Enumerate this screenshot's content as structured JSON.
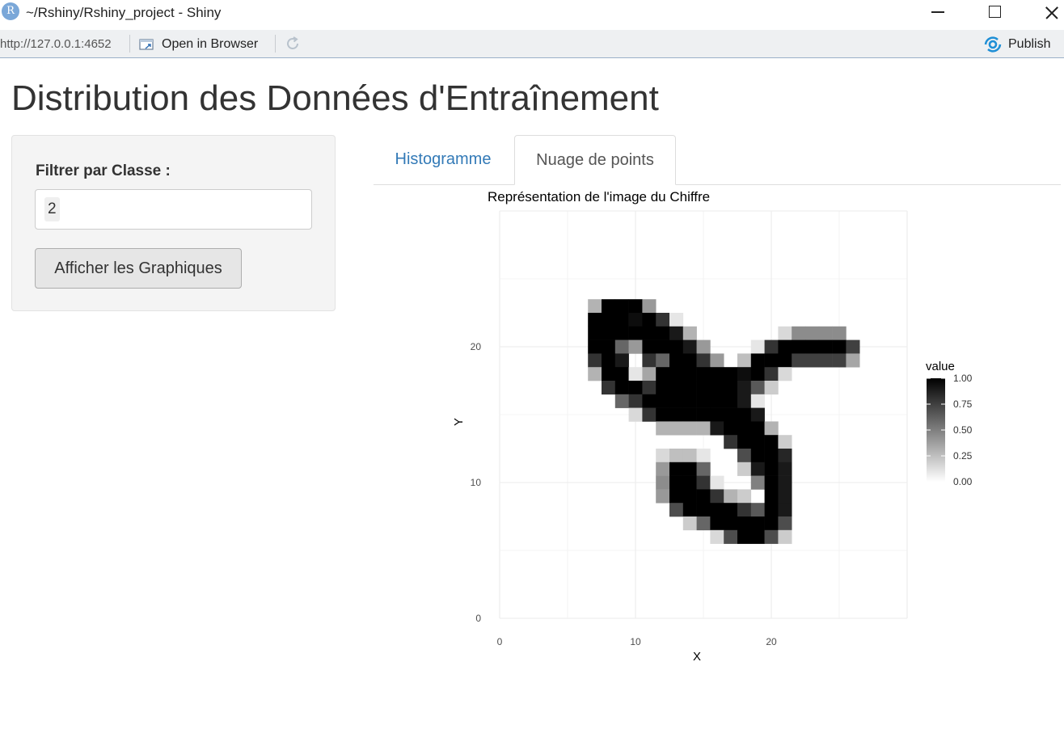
{
  "window": {
    "title": "~/Rshiny/Rshiny_project - Shiny",
    "app_icon": "R"
  },
  "toolbar": {
    "url": "http://127.0.0.1:4652",
    "open_in_browser": "Open in Browser",
    "publish": "Publish"
  },
  "page": {
    "title": "Distribution des Données d'Entraînement"
  },
  "sidebar": {
    "filter_label": "Filtrer par Classe :",
    "selected_class": "2",
    "show_button": "Afficher les Graphiques"
  },
  "tabs": [
    {
      "label": "Histogramme",
      "active": false
    },
    {
      "label": "Nuage de points",
      "active": true
    }
  ],
  "chart_data": {
    "type": "heatmap",
    "title": "Représentation de l'image du Chiffre",
    "xlabel": "X",
    "ylabel": "Y",
    "xlim": [
      0,
      30
    ],
    "ylim": [
      0,
      30
    ],
    "x_ticks": [
      0,
      10,
      20
    ],
    "y_ticks": [
      0,
      10,
      20
    ],
    "grid": true,
    "legend": {
      "title": "value",
      "position": "right",
      "ticks": [
        "1.00",
        "0.75",
        "0.50",
        "0.25",
        "0.00"
      ],
      "low_color": "#ffffff",
      "high_color": "#000000"
    },
    "cells": [
      [
        7,
        23,
        0.3
      ],
      [
        8,
        23,
        1
      ],
      [
        9,
        23,
        1
      ],
      [
        10,
        23,
        1
      ],
      [
        11,
        23,
        0.4
      ],
      [
        7,
        22,
        1
      ],
      [
        8,
        22,
        1
      ],
      [
        9,
        22,
        1
      ],
      [
        10,
        22,
        0.95
      ],
      [
        11,
        22,
        1
      ],
      [
        12,
        22,
        0.8
      ],
      [
        13,
        22,
        0.1
      ],
      [
        7,
        21,
        1
      ],
      [
        8,
        21,
        1
      ],
      [
        9,
        21,
        1
      ],
      [
        10,
        21,
        1
      ],
      [
        11,
        21,
        1
      ],
      [
        12,
        21,
        1
      ],
      [
        13,
        21,
        0.9
      ],
      [
        14,
        21,
        0.3
      ],
      [
        21,
        21,
        0.15
      ],
      [
        22,
        21,
        0.45
      ],
      [
        23,
        21,
        0.45
      ],
      [
        24,
        21,
        0.45
      ],
      [
        25,
        21,
        0.45
      ],
      [
        7,
        20,
        1
      ],
      [
        8,
        20,
        1
      ],
      [
        9,
        20,
        0.6
      ],
      [
        10,
        20,
        0.4
      ],
      [
        11,
        20,
        1
      ],
      [
        12,
        20,
        1
      ],
      [
        13,
        20,
        1
      ],
      [
        14,
        20,
        0.9
      ],
      [
        15,
        20,
        0.4
      ],
      [
        19,
        20,
        0.1
      ],
      [
        20,
        20,
        0.8
      ],
      [
        21,
        20,
        1
      ],
      [
        22,
        20,
        1
      ],
      [
        23,
        20,
        1
      ],
      [
        24,
        20,
        1
      ],
      [
        25,
        20,
        1
      ],
      [
        26,
        20,
        0.75
      ],
      [
        7,
        19,
        0.8
      ],
      [
        8,
        19,
        1
      ],
      [
        9,
        19,
        0.9
      ],
      [
        11,
        19,
        0.8
      ],
      [
        12,
        19,
        0.6
      ],
      [
        13,
        19,
        1
      ],
      [
        14,
        19,
        1
      ],
      [
        15,
        19,
        0.8
      ],
      [
        16,
        19,
        0.4
      ],
      [
        18,
        19,
        0.25
      ],
      [
        19,
        19,
        1
      ],
      [
        20,
        19,
        1
      ],
      [
        21,
        19,
        1
      ],
      [
        22,
        19,
        0.75
      ],
      [
        23,
        19,
        0.75
      ],
      [
        24,
        19,
        0.75
      ],
      [
        25,
        19,
        0.75
      ],
      [
        26,
        19,
        0.35
      ],
      [
        7,
        18,
        0.3
      ],
      [
        8,
        18,
        1
      ],
      [
        9,
        18,
        1
      ],
      [
        10,
        18,
        0.1
      ],
      [
        11,
        18,
        0.35
      ],
      [
        12,
        18,
        1
      ],
      [
        13,
        18,
        1
      ],
      [
        14,
        18,
        1
      ],
      [
        15,
        18,
        1
      ],
      [
        16,
        18,
        1
      ],
      [
        17,
        18,
        1
      ],
      [
        18,
        18,
        0.95
      ],
      [
        19,
        18,
        1
      ],
      [
        20,
        18,
        0.8
      ],
      [
        21,
        18,
        0.15
      ],
      [
        8,
        17,
        0.8
      ],
      [
        9,
        17,
        1
      ],
      [
        10,
        17,
        1
      ],
      [
        11,
        17,
        0.8
      ],
      [
        12,
        17,
        1
      ],
      [
        13,
        17,
        1
      ],
      [
        14,
        17,
        1
      ],
      [
        15,
        17,
        1
      ],
      [
        16,
        17,
        1
      ],
      [
        17,
        17,
        1
      ],
      [
        18,
        17,
        0.9
      ],
      [
        19,
        17,
        0.65
      ],
      [
        20,
        17,
        0.2
      ],
      [
        9,
        16,
        0.6
      ],
      [
        10,
        16,
        0.8
      ],
      [
        11,
        16,
        1
      ],
      [
        12,
        16,
        1
      ],
      [
        13,
        16,
        1
      ],
      [
        14,
        16,
        1
      ],
      [
        15,
        16,
        1
      ],
      [
        16,
        16,
        1
      ],
      [
        17,
        16,
        1
      ],
      [
        18,
        16,
        0.9
      ],
      [
        19,
        16,
        0.1
      ],
      [
        10,
        15,
        0.15
      ],
      [
        11,
        15,
        0.8
      ],
      [
        12,
        15,
        1
      ],
      [
        13,
        15,
        1
      ],
      [
        14,
        15,
        1
      ],
      [
        15,
        15,
        1
      ],
      [
        16,
        15,
        1
      ],
      [
        17,
        15,
        1
      ],
      [
        18,
        15,
        1
      ],
      [
        19,
        15,
        0.9
      ],
      [
        12,
        14,
        0.3
      ],
      [
        13,
        14,
        0.3
      ],
      [
        14,
        14,
        0.3
      ],
      [
        15,
        14,
        0.3
      ],
      [
        16,
        14,
        0.9
      ],
      [
        17,
        14,
        1
      ],
      [
        18,
        14,
        1
      ],
      [
        19,
        14,
        1
      ],
      [
        20,
        14,
        0.3
      ],
      [
        17,
        13,
        0.8
      ],
      [
        18,
        13,
        1
      ],
      [
        19,
        13,
        1
      ],
      [
        20,
        13,
        1
      ],
      [
        21,
        13,
        0.2
      ],
      [
        12,
        12,
        0.15
      ],
      [
        13,
        12,
        0.25
      ],
      [
        14,
        12,
        0.25
      ],
      [
        15,
        12,
        0.1
      ],
      [
        18,
        12,
        0.7
      ],
      [
        19,
        12,
        1
      ],
      [
        20,
        12,
        1
      ],
      [
        21,
        12,
        0.85
      ],
      [
        12,
        11,
        0.4
      ],
      [
        13,
        11,
        1
      ],
      [
        14,
        11,
        1
      ],
      [
        15,
        11,
        0.6
      ],
      [
        18,
        11,
        0.2
      ],
      [
        19,
        11,
        0.9
      ],
      [
        20,
        11,
        1
      ],
      [
        21,
        11,
        0.9
      ],
      [
        12,
        10,
        0.45
      ],
      [
        13,
        10,
        1
      ],
      [
        14,
        10,
        1
      ],
      [
        15,
        10,
        0.8
      ],
      [
        16,
        10,
        0.1
      ],
      [
        19,
        10,
        0.5
      ],
      [
        20,
        10,
        1
      ],
      [
        21,
        10,
        0.9
      ],
      [
        12,
        9,
        0.4
      ],
      [
        13,
        9,
        1
      ],
      [
        14,
        9,
        1
      ],
      [
        15,
        9,
        1
      ],
      [
        16,
        9,
        0.8
      ],
      [
        17,
        9,
        0.3
      ],
      [
        18,
        9,
        0.2
      ],
      [
        20,
        9,
        1
      ],
      [
        21,
        9,
        0.9
      ],
      [
        13,
        8,
        0.7
      ],
      [
        14,
        8,
        1
      ],
      [
        15,
        8,
        1
      ],
      [
        16,
        8,
        1
      ],
      [
        17,
        8,
        1
      ],
      [
        18,
        8,
        0.8
      ],
      [
        19,
        8,
        0.65
      ],
      [
        20,
        8,
        1
      ],
      [
        21,
        8,
        0.9
      ],
      [
        14,
        7,
        0.2
      ],
      [
        15,
        7,
        0.6
      ],
      [
        16,
        7,
        1
      ],
      [
        17,
        7,
        1
      ],
      [
        18,
        7,
        1
      ],
      [
        19,
        7,
        1
      ],
      [
        20,
        7,
        1
      ],
      [
        21,
        7,
        0.7
      ],
      [
        16,
        6,
        0.15
      ],
      [
        17,
        6,
        0.7
      ],
      [
        18,
        6,
        1
      ],
      [
        19,
        6,
        1
      ],
      [
        20,
        6,
        0.7
      ],
      [
        21,
        6,
        0.2
      ]
    ]
  }
}
